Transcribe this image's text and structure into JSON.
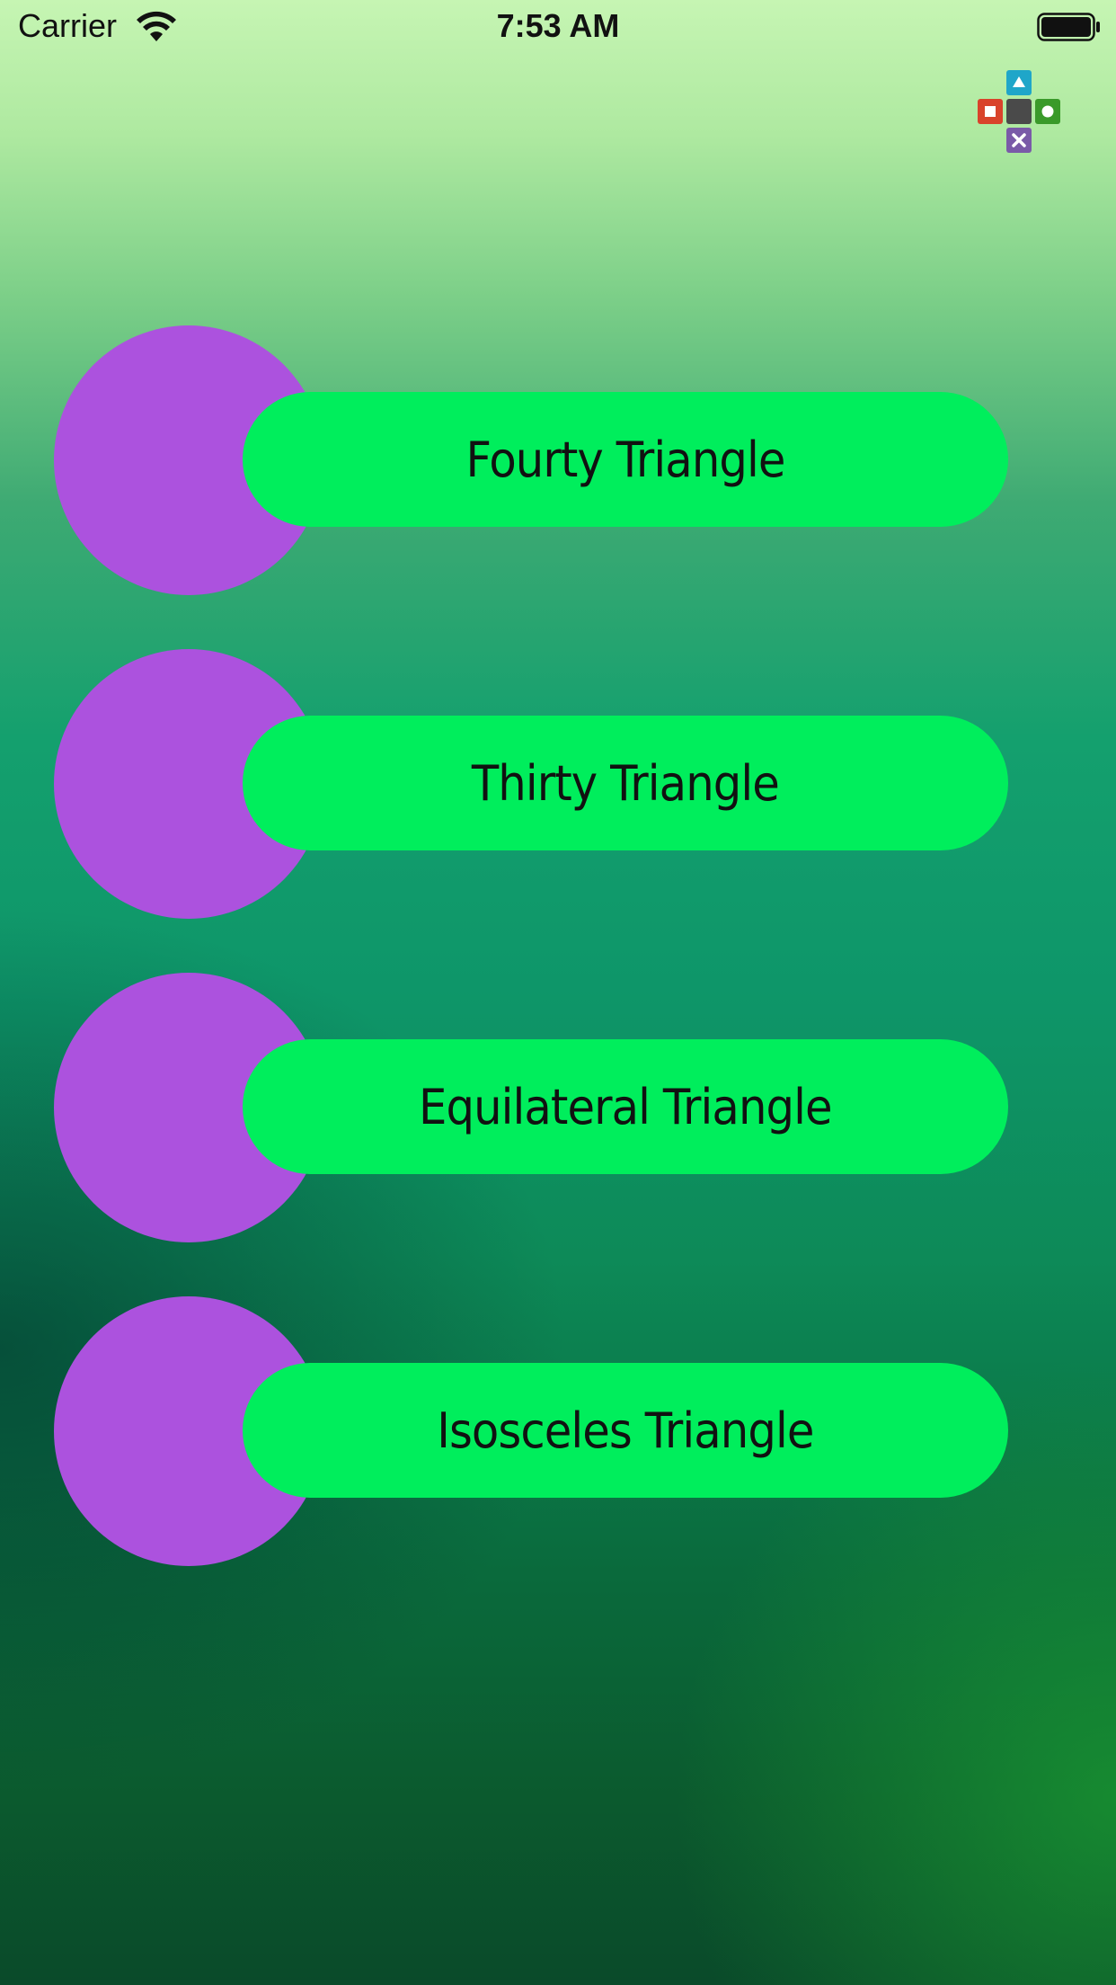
{
  "status_bar": {
    "carrier": "Carrier",
    "time": "7:53 AM"
  },
  "app_logo": {
    "icon": "game-controls-logo-icon",
    "tile_colors": {
      "top": "#1fa6c9",
      "left": "#d9432b",
      "center": "#4a4a4a",
      "right": "#3a9a2a",
      "bottom": "#7a5aa8"
    }
  },
  "menu": {
    "items": [
      {
        "label": "Fourty Triangle"
      },
      {
        "label": "Thirty Triangle"
      },
      {
        "label": "Equilateral Triangle"
      },
      {
        "label": "Isosceles Triangle"
      }
    ]
  },
  "colors": {
    "circle": "#ac52de",
    "button": "#00ee5c",
    "button_text": "#111111"
  }
}
